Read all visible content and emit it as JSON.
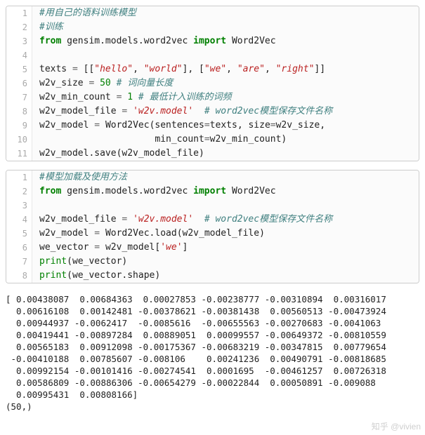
{
  "block1": {
    "lines": [
      {
        "no": "1",
        "tokens": [
          {
            "c": "tok-comment",
            "t": "#用自己的语料训练模型"
          }
        ]
      },
      {
        "no": "2",
        "tokens": [
          {
            "c": "tok-comment",
            "t": "#训练"
          }
        ]
      },
      {
        "no": "3",
        "tokens": [
          {
            "c": "tok-keyword",
            "t": "from"
          },
          {
            "c": "",
            "t": " "
          },
          {
            "c": "tok-name",
            "t": "gensim.models.word2vec"
          },
          {
            "c": "",
            "t": " "
          },
          {
            "c": "tok-keyword",
            "t": "import"
          },
          {
            "c": "",
            "t": " "
          },
          {
            "c": "tok-name",
            "t": "Word2Vec"
          }
        ]
      },
      {
        "no": "4",
        "tokens": []
      },
      {
        "no": "5",
        "tokens": [
          {
            "c": "tok-name",
            "t": "texts"
          },
          {
            "c": "",
            "t": " "
          },
          {
            "c": "tok-op",
            "t": "="
          },
          {
            "c": "",
            "t": " [["
          },
          {
            "c": "tok-string",
            "t": "\"hello\""
          },
          {
            "c": "",
            "t": ", "
          },
          {
            "c": "tok-string",
            "t": "\"world\""
          },
          {
            "c": "",
            "t": "], ["
          },
          {
            "c": "tok-string",
            "t": "\"we\""
          },
          {
            "c": "",
            "t": ", "
          },
          {
            "c": "tok-string",
            "t": "\"are\""
          },
          {
            "c": "",
            "t": ", "
          },
          {
            "c": "tok-string",
            "t": "\"right\""
          },
          {
            "c": "",
            "t": "]]"
          }
        ]
      },
      {
        "no": "6",
        "tokens": [
          {
            "c": "tok-name",
            "t": "w2v_size"
          },
          {
            "c": "",
            "t": " "
          },
          {
            "c": "tok-op",
            "t": "="
          },
          {
            "c": "",
            "t": " "
          },
          {
            "c": "tok-number",
            "t": "50"
          },
          {
            "c": "",
            "t": " "
          },
          {
            "c": "tok-comment",
            "t": "# 词向量长度"
          }
        ]
      },
      {
        "no": "7",
        "tokens": [
          {
            "c": "tok-name",
            "t": "w2v_min_count"
          },
          {
            "c": "",
            "t": " "
          },
          {
            "c": "tok-op",
            "t": "="
          },
          {
            "c": "",
            "t": " "
          },
          {
            "c": "tok-number",
            "t": "1"
          },
          {
            "c": "",
            "t": " "
          },
          {
            "c": "tok-comment",
            "t": "# 最低计入训练的词频"
          }
        ]
      },
      {
        "no": "8",
        "tokens": [
          {
            "c": "tok-name",
            "t": "w2v_model_file"
          },
          {
            "c": "",
            "t": " "
          },
          {
            "c": "tok-op",
            "t": "="
          },
          {
            "c": "",
            "t": " "
          },
          {
            "c": "tok-string",
            "t": "'w2v.model'"
          },
          {
            "c": "",
            "t": "  "
          },
          {
            "c": "tok-comment",
            "t": "# word2vec模型保存文件名称"
          }
        ]
      },
      {
        "no": "9",
        "tokens": [
          {
            "c": "tok-name",
            "t": "w2v_model"
          },
          {
            "c": "",
            "t": " "
          },
          {
            "c": "tok-op",
            "t": "="
          },
          {
            "c": "",
            "t": " "
          },
          {
            "c": "tok-name",
            "t": "Word2Vec"
          },
          {
            "c": "",
            "t": "("
          },
          {
            "c": "tok-name",
            "t": "sentences"
          },
          {
            "c": "tok-op",
            "t": "="
          },
          {
            "c": "tok-name",
            "t": "texts"
          },
          {
            "c": "",
            "t": ", "
          },
          {
            "c": "tok-name",
            "t": "size"
          },
          {
            "c": "tok-op",
            "t": "="
          },
          {
            "c": "tok-name",
            "t": "w2v_size"
          },
          {
            "c": "",
            "t": ","
          }
        ]
      },
      {
        "no": "10",
        "tokens": [
          {
            "c": "",
            "t": "                     "
          },
          {
            "c": "tok-name",
            "t": "min_count"
          },
          {
            "c": "tok-op",
            "t": "="
          },
          {
            "c": "tok-name",
            "t": "w2v_min_count"
          },
          {
            "c": "",
            "t": ")"
          }
        ]
      },
      {
        "no": "11",
        "tokens": [
          {
            "c": "tok-name",
            "t": "w2v_model.save"
          },
          {
            "c": "",
            "t": "("
          },
          {
            "c": "tok-name",
            "t": "w2v_model_file"
          },
          {
            "c": "",
            "t": ")"
          }
        ]
      }
    ]
  },
  "block2": {
    "lines": [
      {
        "no": "1",
        "tokens": [
          {
            "c": "tok-comment",
            "t": "#模型加载及使用方法"
          }
        ]
      },
      {
        "no": "2",
        "tokens": [
          {
            "c": "tok-keyword",
            "t": "from"
          },
          {
            "c": "",
            "t": " "
          },
          {
            "c": "tok-name",
            "t": "gensim.models.word2vec"
          },
          {
            "c": "",
            "t": " "
          },
          {
            "c": "tok-keyword",
            "t": "import"
          },
          {
            "c": "",
            "t": " "
          },
          {
            "c": "tok-name",
            "t": "Word2Vec"
          }
        ]
      },
      {
        "no": "3",
        "tokens": []
      },
      {
        "no": "4",
        "tokens": [
          {
            "c": "tok-name",
            "t": "w2v_model_file"
          },
          {
            "c": "",
            "t": " "
          },
          {
            "c": "tok-op",
            "t": "="
          },
          {
            "c": "",
            "t": " "
          },
          {
            "c": "tok-string",
            "t": "'w2v.model'"
          },
          {
            "c": "",
            "t": "  "
          },
          {
            "c": "tok-comment",
            "t": "# word2vec模型保存文件名称"
          }
        ]
      },
      {
        "no": "5",
        "tokens": [
          {
            "c": "tok-name",
            "t": "w2v_model"
          },
          {
            "c": "",
            "t": " "
          },
          {
            "c": "tok-op",
            "t": "="
          },
          {
            "c": "",
            "t": " "
          },
          {
            "c": "tok-name",
            "t": "Word2Vec.load"
          },
          {
            "c": "",
            "t": "("
          },
          {
            "c": "tok-name",
            "t": "w2v_model_file"
          },
          {
            "c": "",
            "t": ")"
          }
        ]
      },
      {
        "no": "6",
        "tokens": [
          {
            "c": "tok-name",
            "t": "we_vector"
          },
          {
            "c": "",
            "t": " "
          },
          {
            "c": "tok-op",
            "t": "="
          },
          {
            "c": "",
            "t": " "
          },
          {
            "c": "tok-name",
            "t": "w2v_model"
          },
          {
            "c": "",
            "t": "["
          },
          {
            "c": "tok-string",
            "t": "'we'"
          },
          {
            "c": "",
            "t": "]"
          }
        ]
      },
      {
        "no": "7",
        "tokens": [
          {
            "c": "tok-builtin",
            "t": "print"
          },
          {
            "c": "",
            "t": "("
          },
          {
            "c": "tok-name",
            "t": "we_vector"
          },
          {
            "c": "",
            "t": ")"
          }
        ]
      },
      {
        "no": "8",
        "tokens": [
          {
            "c": "tok-builtin",
            "t": "print"
          },
          {
            "c": "",
            "t": "("
          },
          {
            "c": "tok-name",
            "t": "we_vector.shape"
          },
          {
            "c": "",
            "t": ")"
          }
        ]
      }
    ]
  },
  "output": {
    "text": "[ 0.00438087  0.00684363  0.00027853 -0.00238777 -0.00310894  0.00316017\n  0.00616108  0.00142481 -0.00378621 -0.00381438  0.00560513 -0.00473924\n  0.00944937 -0.0062417  -0.0085616  -0.00655563 -0.00270683 -0.0041063\n  0.00419441 -0.00897284  0.00889051  0.00099557 -0.00649372 -0.00810559\n  0.00565183  0.00912098 -0.00175367 -0.00683219 -0.00347815  0.00779654\n -0.00410188  0.00785607 -0.008106    0.00241236  0.00490791 -0.00818685\n  0.00992154 -0.00101416 -0.00274541  0.0001695  -0.00461257  0.00726318\n  0.00586809 -0.00886306 -0.00654279 -0.00022844  0.00050891 -0.009088\n  0.00995431  0.00808166]\n(50,)"
  },
  "watermark": "知乎 @vivien"
}
